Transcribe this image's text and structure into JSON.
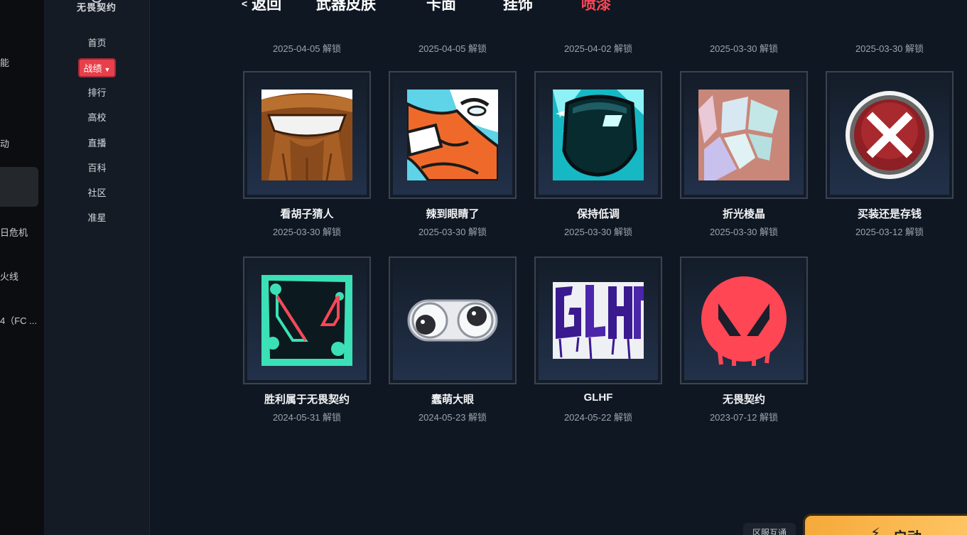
{
  "launcher": {
    "items": [
      {
        "label": "能"
      },
      {
        "label": "动"
      },
      {
        "label": "日危机"
      },
      {
        "label": "火线"
      },
      {
        "label": "4（FC ..."
      }
    ]
  },
  "nav": {
    "logo_text": "无畏契约",
    "items": [
      {
        "label": "首页"
      },
      {
        "label": "战绩"
      },
      {
        "label": "排行"
      },
      {
        "label": "高校"
      },
      {
        "label": "直播"
      },
      {
        "label": "百科"
      },
      {
        "label": "社区"
      },
      {
        "label": "准星"
      }
    ],
    "active_accent": "#e8404a"
  },
  "tabs": {
    "back": "返回",
    "items": [
      "武器皮肤",
      "卡面",
      "挂饰",
      "喷漆"
    ],
    "active": "喷漆",
    "active_color": "#ff4655"
  },
  "top_row": [
    {
      "date": "2025-04-05 解锁"
    },
    {
      "date": "2025-04-05 解锁"
    },
    {
      "date": "2025-04-02 解锁"
    },
    {
      "date": "2025-03-30 解锁"
    },
    {
      "date": "2025-03-30 解锁"
    }
  ],
  "sprays": [
    {
      "name": "看胡子猜人",
      "date": "2025-03-30 解锁",
      "icon": "beard-face-icon"
    },
    {
      "name": "辣到眼睛了",
      "date": "2025-03-30 解锁",
      "icon": "spicy-eyes-icon"
    },
    {
      "name": "保持低调",
      "date": "2025-03-30 解锁",
      "icon": "sunglasses-icon"
    },
    {
      "name": "折光棱晶",
      "date": "2025-03-30 解锁",
      "icon": "prism-crystal-icon"
    },
    {
      "name": "买装还是存钱",
      "date": "2025-03-12 解锁",
      "icon": "red-x-icon"
    },
    {
      "name": "胜利属于无畏契约",
      "date": "2024-05-31 解锁",
      "icon": "valorant-splash-icon"
    },
    {
      "name": "蠢萌大眼",
      "date": "2024-05-23 解锁",
      "icon": "googly-eyes-icon"
    },
    {
      "name": "GLHF",
      "date": "2024-05-22 解锁",
      "icon": "glhf-graffiti-icon"
    },
    {
      "name": "无畏契约",
      "date": "2023-07-12 解锁",
      "icon": "valorant-logo-icon"
    }
  ],
  "footer": {
    "region_badge": "区服互通",
    "launch_label": "启动"
  }
}
